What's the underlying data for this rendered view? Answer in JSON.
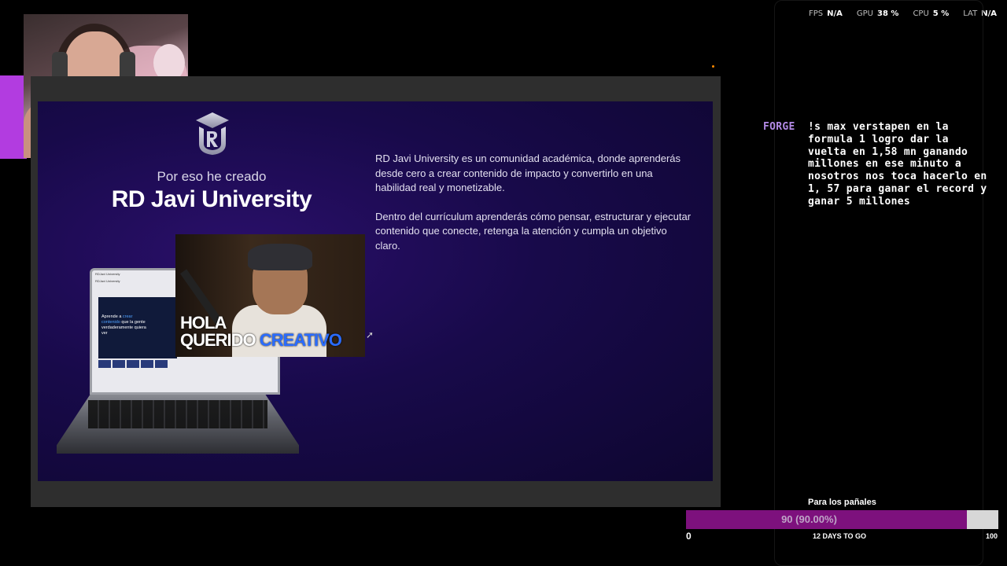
{
  "stats": [
    {
      "key": "FPS",
      "value": "N/A"
    },
    {
      "key": "GPU",
      "value": "38 %"
    },
    {
      "key": "CPU",
      "value": "5 %"
    },
    {
      "key": "LAT",
      "value": "N/A"
    }
  ],
  "chat": {
    "username": "FORGE",
    "message": "!s max verstapen en la formula 1 logro dar la vuelta en 1,58 mn ganando millones en ese minuto a nosotros nos toca hacerlo en 1, 57 para ganar el record y ganar 5 millones",
    "username_color": "#b38ae6"
  },
  "slide": {
    "kicker": "Por eso he creado",
    "headline": "RD Javi University",
    "paragraphs": [
      "RD Javi University es un comunidad académica, donde aprenderás desde cero a crear contenido de impacto y convertirlo en una habilidad real y monetizable.",
      "Dentro del currículum aprenderás cómo pensar, estructurar y ejecutar contenido que conecte, retenga la atención y cumpla un objetivo claro."
    ],
    "laptop": {
      "site_name": "RDJavi University",
      "section": "RDJavi University",
      "hero_part1": "Aprende a",
      "hero_accent": "crear contenido",
      "hero_part2": "que la gente verdaderamente quiera ver"
    },
    "video_caption_line1": "HOLA",
    "video_caption_line2": "QUERIDO",
    "video_caption_accent": "CREATIVO",
    "accent_color": "#2a6cff"
  },
  "goal": {
    "title": "Para los pañales",
    "progress_text": "90 (90.00%)",
    "progress_fraction": 0.9,
    "min": "0",
    "max": "100",
    "days_left": "12 DAYS TO GO",
    "fill_color": "#7d117d"
  }
}
